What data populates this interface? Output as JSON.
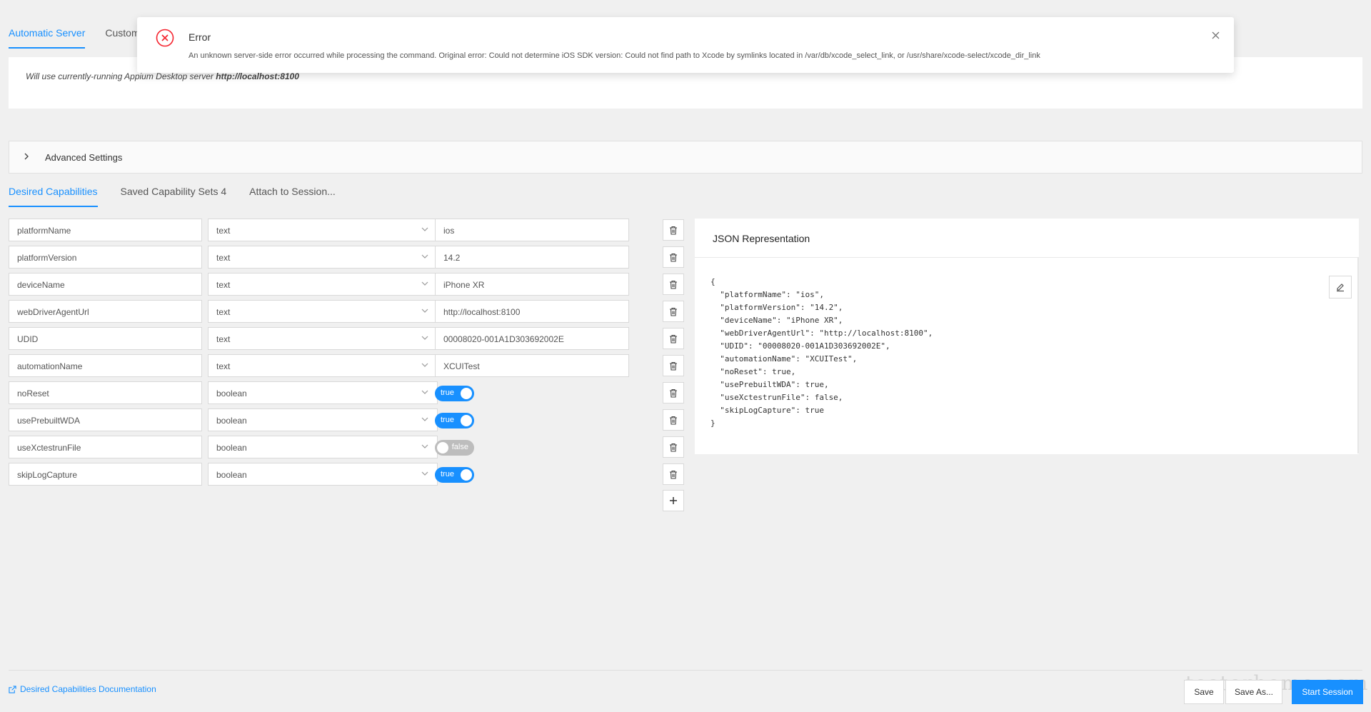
{
  "top_tabs": [
    "Automatic Server",
    "Custom"
  ],
  "server": {
    "prefix": "Will use currently-running Appium Desktop server ",
    "url": "http://localhost:8100"
  },
  "advanced_settings_label": "Advanced Settings",
  "cap_tabs": [
    "Desired Capabilities",
    "Saved Capability Sets 4",
    "Attach to Session..."
  ],
  "capabilities": [
    {
      "name": "platformName",
      "type": "text",
      "value": "ios"
    },
    {
      "name": "platformVersion",
      "type": "text",
      "value": "14.2"
    },
    {
      "name": "deviceName",
      "type": "text",
      "value": "iPhone XR"
    },
    {
      "name": "webDriverAgentUrl",
      "type": "text",
      "value": "http://localhost:8100"
    },
    {
      "name": "UDID",
      "type": "text",
      "value": "00008020-001A1D303692002E"
    },
    {
      "name": "automationName",
      "type": "text",
      "value": "XCUITest"
    },
    {
      "name": "noReset",
      "type": "boolean",
      "value": "true"
    },
    {
      "name": "usePrebuiltWDA",
      "type": "boolean",
      "value": "true"
    },
    {
      "name": "useXctestrunFile",
      "type": "boolean",
      "value": "false"
    },
    {
      "name": "skipLogCapture",
      "type": "boolean",
      "value": "true"
    }
  ],
  "json_panel": {
    "title": "JSON Representation",
    "text": "{\n  \"platformName\": \"ios\",\n  \"platformVersion\": \"14.2\",\n  \"deviceName\": \"iPhone XR\",\n  \"webDriverAgentUrl\": \"http://localhost:8100\",\n  \"UDID\": \"00008020-001A1D303692002E\",\n  \"automationName\": \"XCUITest\",\n  \"noReset\": true,\n  \"usePrebuiltWDA\": true,\n  \"useXctestrunFile\": false,\n  \"skipLogCapture\": true\n}"
  },
  "footer": {
    "doc_link": "Desired Capabilities Documentation",
    "save": "Save",
    "save_as": "Save As...",
    "start": "Start Session"
  },
  "watermark": "testerhome.com",
  "error": {
    "title": "Error",
    "message": "An unknown server-side error occurred while processing the command. Original error: Could not determine iOS SDK version: Could not find path to Xcode by symlinks located in /var/db/xcode_select_link, or /usr/share/xcode-select/xcode_dir_link"
  },
  "colors": {
    "accent": "#1890ff",
    "error": "#f5222d",
    "background": "#f0f0f0"
  }
}
